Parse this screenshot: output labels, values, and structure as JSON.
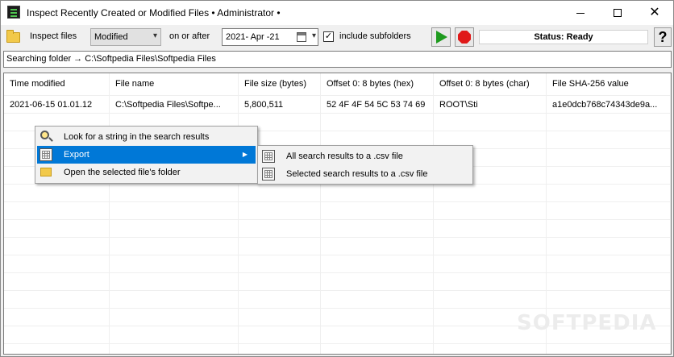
{
  "window": {
    "title": "Inspect Recently Created or Modified Files • Administrator •"
  },
  "toolbar": {
    "inspect_label": "Inspect files",
    "mode_value": "Modified",
    "on_or_after_label": "on or after",
    "date_value": "2021- Apr -21",
    "include_subfolders_label": "include subfolders",
    "include_subfolders_checked": true,
    "status_text": "Status: Ready",
    "help_label": "?"
  },
  "path": {
    "text": "Searching folder → C:\\Softpedia Files\\Softpedia Files"
  },
  "table": {
    "columns": [
      "Time modified",
      "File name",
      "File size (bytes)",
      "Offset 0: 8 bytes (hex)",
      "Offset 0: 8 bytes (char)",
      "File SHA-256 value"
    ],
    "rows": [
      [
        "2021-06-15 01.01.12",
        "C:\\Softpedia Files\\Softpe...",
        "5,800,511",
        "52 4F 4F 54 5C 53 74 69",
        "ROOT\\Sti",
        "a1e0dcb768c74343de9a..."
      ]
    ]
  },
  "context_menu": {
    "items": [
      {
        "label": "Look for a string in the search results",
        "icon": "magnifier-icon"
      },
      {
        "label": "Export",
        "icon": "grid-icon",
        "has_submenu": true,
        "active": true
      },
      {
        "label": "Open the selected file's folder",
        "icon": "folder-open-icon"
      }
    ],
    "submenu": [
      {
        "label": "All search results to a .csv file",
        "icon": "grid-icon"
      },
      {
        "label": "Selected search results to a .csv file",
        "icon": "grid-icon"
      }
    ]
  },
  "watermark": "SOFTPEDIA",
  "colors": {
    "highlight": "#0078d7",
    "play_green": "#1e9a1e",
    "stop_red": "#e01919"
  }
}
